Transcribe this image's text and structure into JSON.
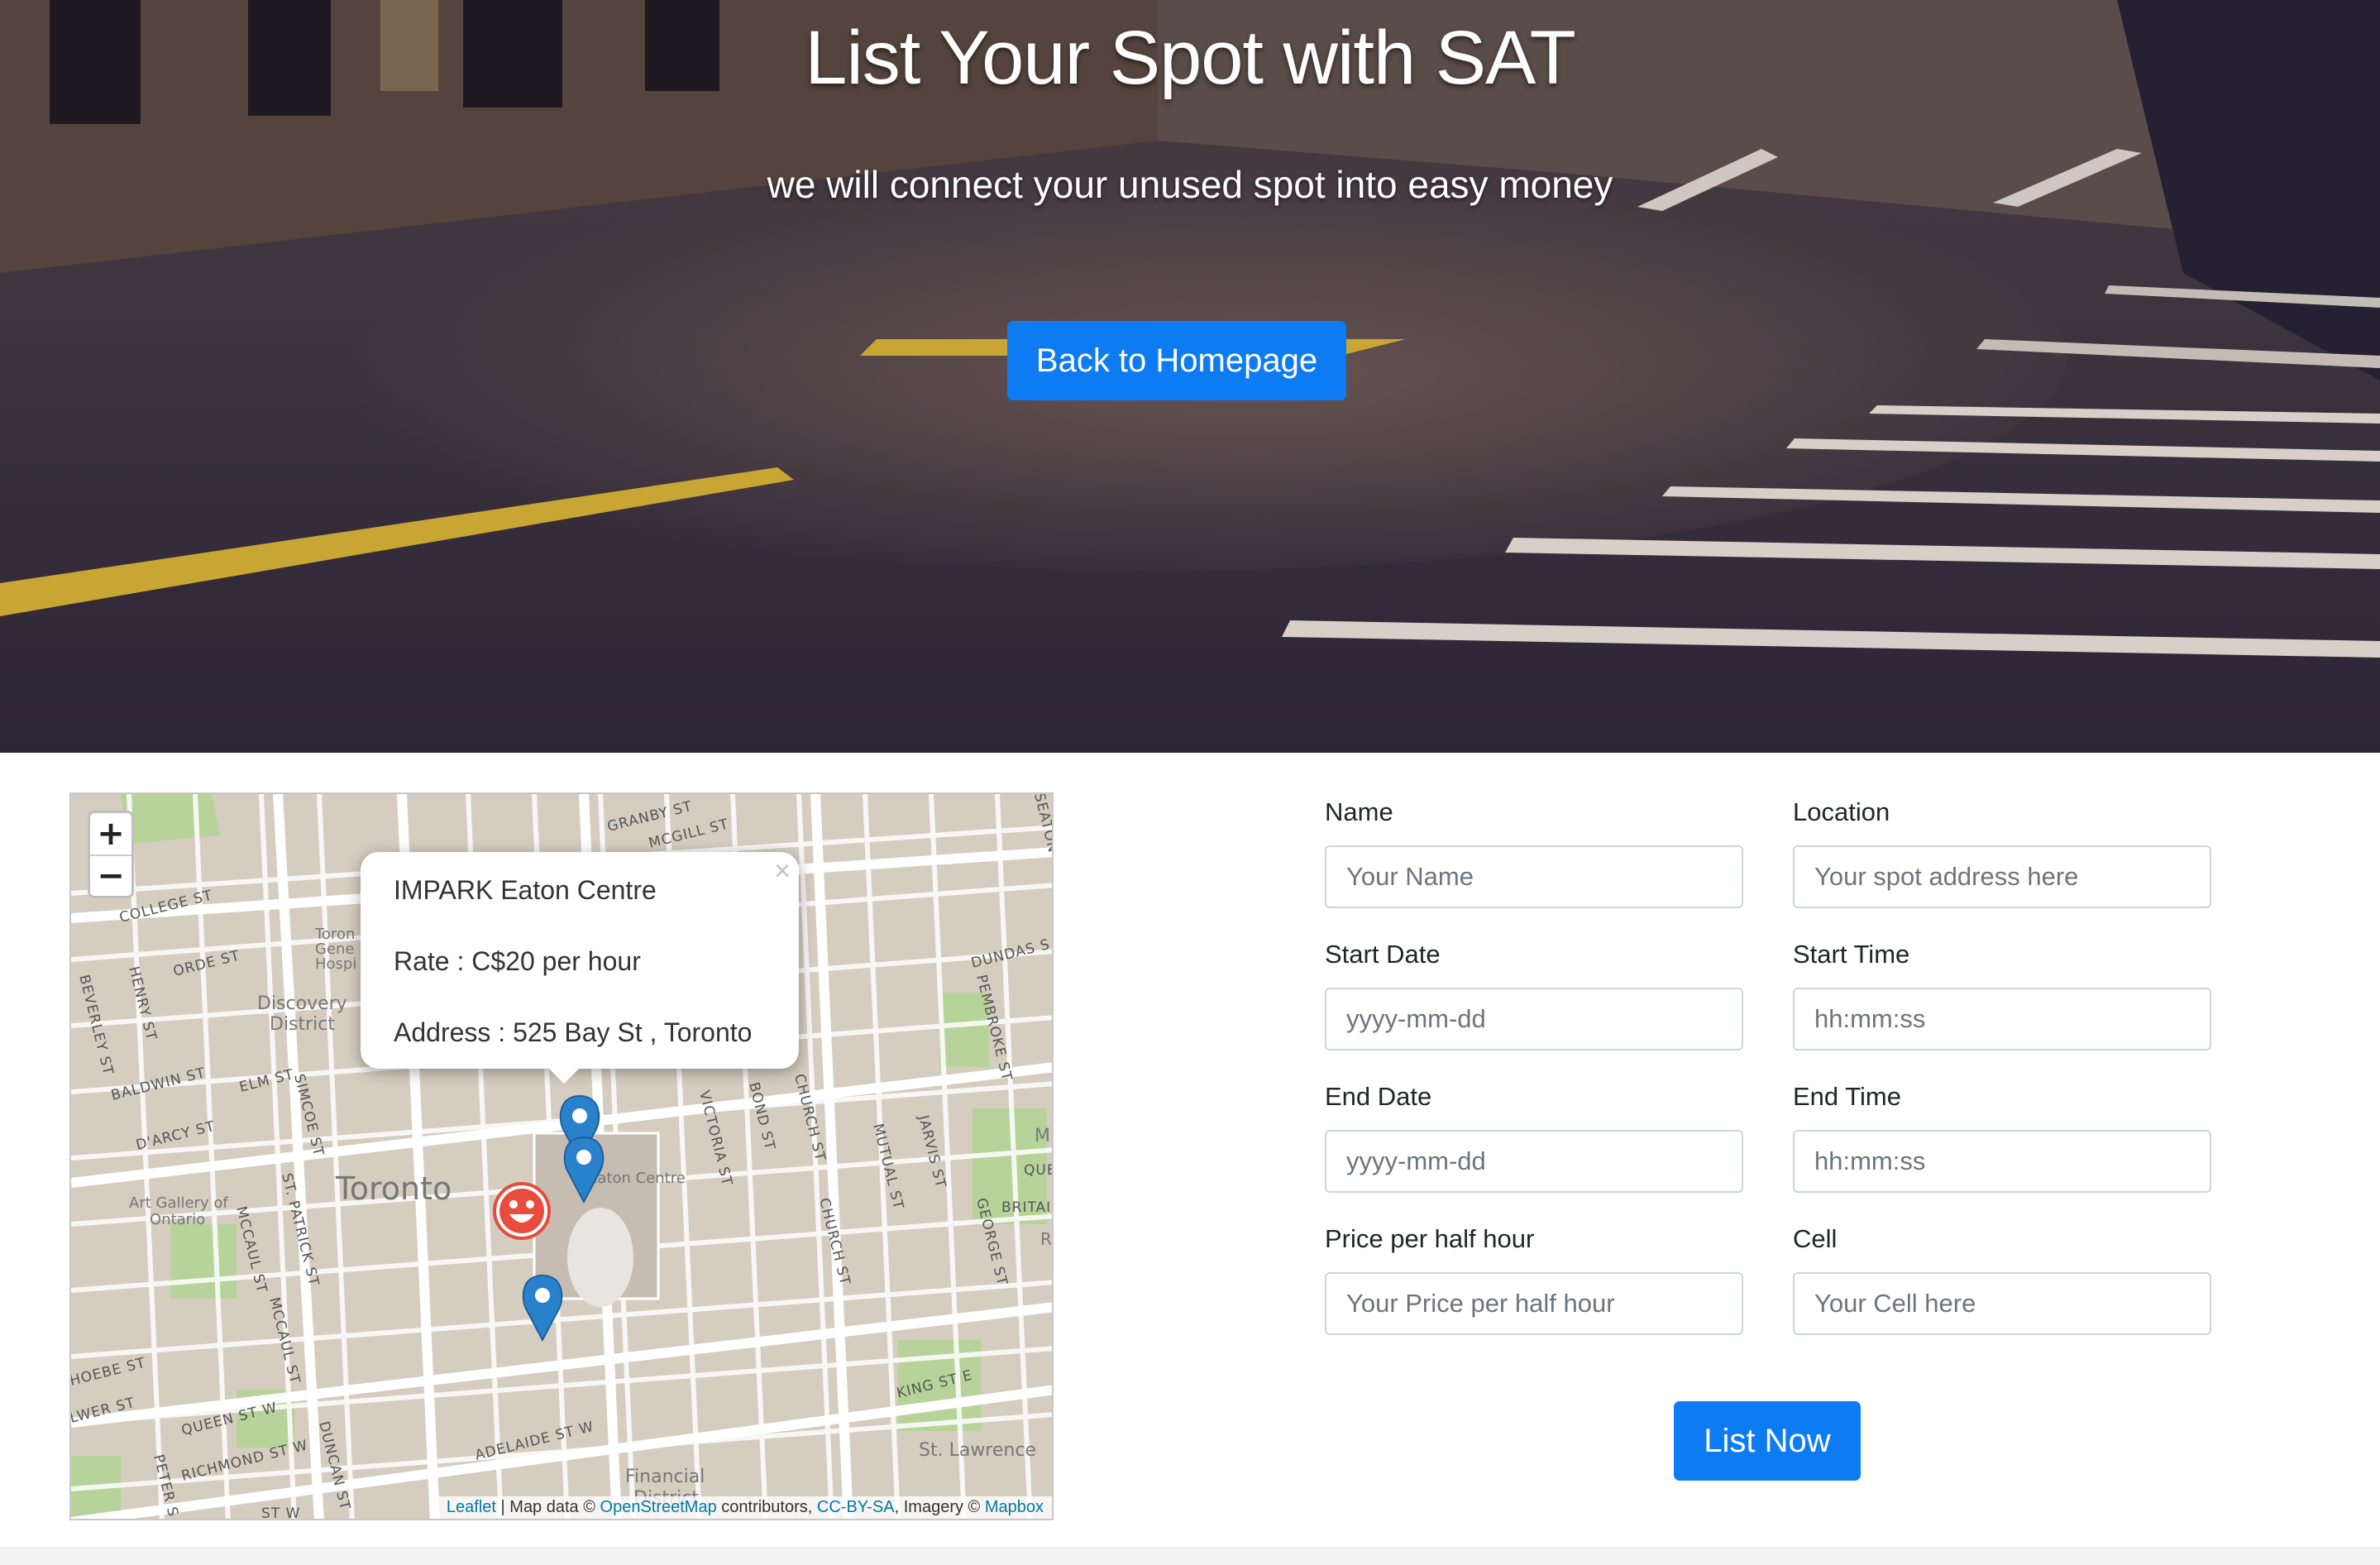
{
  "hero": {
    "title": "List Your Spot with SAT",
    "subtitle": "we will connect your unused spot into easy money",
    "back_button": "Back to Homepage"
  },
  "map": {
    "zoom_in": "+",
    "zoom_out": "−",
    "popup": {
      "name": "IMPARK Eaton Centre",
      "rate": "Rate : C$20 per hour",
      "address": "Address : 525 Bay St , Toronto",
      "close": "×"
    },
    "labels": {
      "city": "Toronto",
      "discovery": "Discovery",
      "district": "District",
      "eaton": "Eaton Centre",
      "art_gallery": "Art Gallery of",
      "ontario": "Ontario",
      "financial": "Financial",
      "financial_district": "District",
      "st_lawrence": "St. Lawrence",
      "toronto_general": "Toron",
      "gene": "Gene",
      "hosp": "Hospi"
    },
    "streets": {
      "college": "COLLEGE ST",
      "orde": "ORDE ST",
      "baldwin": "BALDWIN ST",
      "elm": "ELM ST",
      "darcy": "D'ARCY ST",
      "beverley": "BEVERLEY ST",
      "henry": "HENRY ST",
      "mccaul1": "MCCAUL ST",
      "mccaul2": "MCCAUL ST",
      "simcoe": "SIMCOE ST",
      "stpatrick": "ST. PATRICK ST",
      "queen": "QUEEN ST W",
      "richmond": "RICHMOND ST W",
      "adelaide": "ADELAIDE ST W",
      "king": "KING ST E",
      "dundas": "DUNDAS S",
      "victoria": "VICTORIA ST",
      "bond": "BOND ST",
      "church1": "CHURCH ST",
      "church2": "CHURCH ST",
      "mutual": "MUTUAL ST",
      "jarvis": "JARVIS ST",
      "george": "GEORGE ST",
      "pembroke": "PEMBROKE ST",
      "granby": "GRANBY ST",
      "mcgill": "MCGILL ST",
      "seaton": "SEATON",
      "duncan": "DUNCAN ST",
      "peter": "PETER S",
      "phoebe": "HOEBE ST",
      "lower": "LWER ST",
      "queen_e": "QUE",
      "britain": "BRITAIN",
      "st_w": "ST W",
      "m_letter": "M",
      "r_letter": "R"
    },
    "attribution": {
      "leaflet": "Leaflet",
      "map_data": " | Map data © ",
      "osm": "OpenStreetMap",
      "contributors": " contributors, ",
      "license": "CC-BY-SA",
      "imagery": ", Imagery © ",
      "mapbox": "Mapbox"
    }
  },
  "form": {
    "name_label": "Name",
    "name_placeholder": "Your Name",
    "location_label": "Location",
    "location_placeholder": "Your spot address here",
    "start_date_label": "Start Date",
    "start_date_placeholder": "yyyy-mm-dd",
    "start_time_label": "Start Time",
    "start_time_placeholder": "hh:mm:ss",
    "end_date_label": "End Date",
    "end_date_placeholder": "yyyy-mm-dd",
    "end_time_label": "End Time",
    "end_time_placeholder": "hh:mm:ss",
    "price_label": "Price per half hour",
    "price_placeholder": "Your Price per half hour",
    "cell_label": "Cell",
    "cell_placeholder": "Your Cell here",
    "submit": "List Now"
  },
  "colors": {
    "primary": "#0d7cf2",
    "link": "#0078a8",
    "marker": "#2a81cb",
    "user_marker": "#e74c3c"
  },
  "icons": {
    "marker": "map-pin-icon",
    "user": "smiley-face-icon",
    "close": "close-icon"
  }
}
